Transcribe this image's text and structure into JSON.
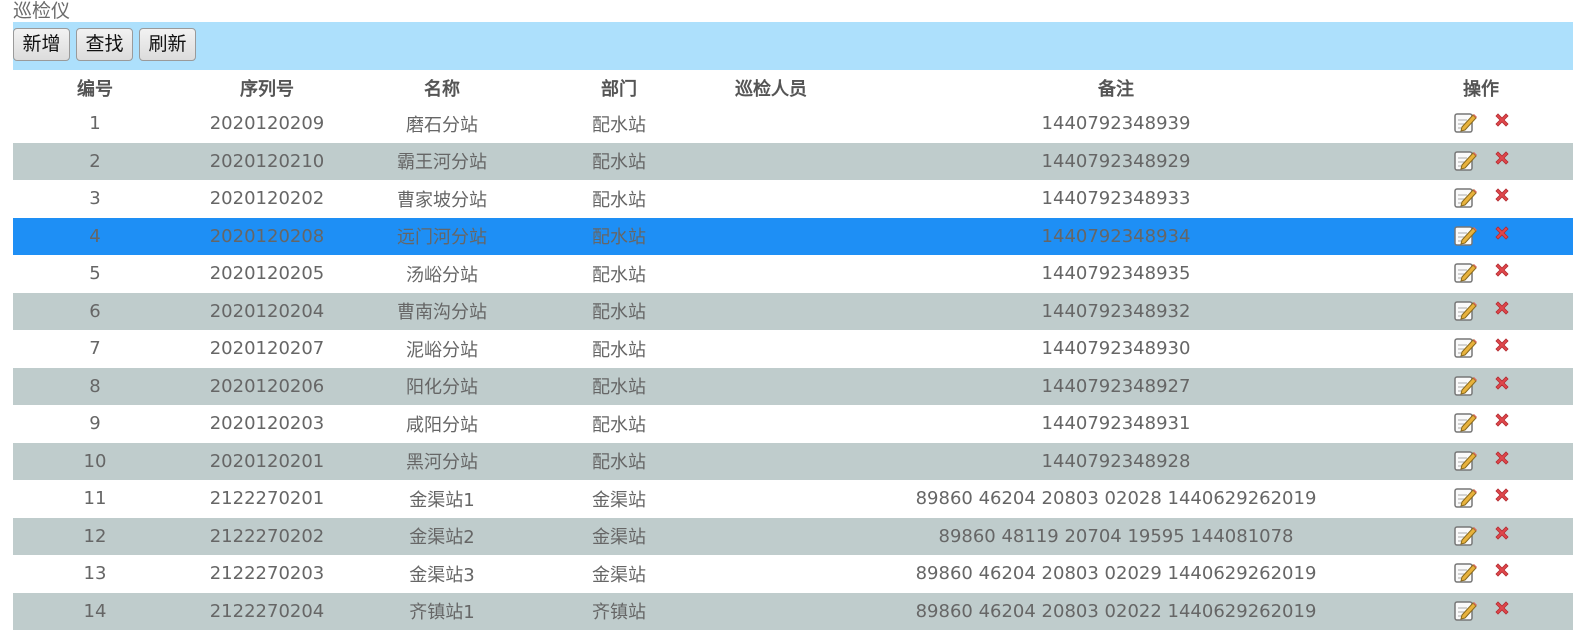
{
  "page": {
    "title": "巡检仪"
  },
  "toolbar": {
    "add_label": "新增",
    "search_label": "查找",
    "refresh_label": "刷新"
  },
  "table": {
    "headers": {
      "no": "编号",
      "seq": "序列号",
      "name": "名称",
      "dept": "部门",
      "inspector": "巡检人员",
      "memo": "备注",
      "ops": "操作"
    },
    "rows": [
      {
        "no": "1",
        "seq": "2020120209",
        "name": "磨石分站",
        "dept": "配水站",
        "inspector": "",
        "memo": "1440792348939"
      },
      {
        "no": "2",
        "seq": "2020120210",
        "name": "霸王河分站",
        "dept": "配水站",
        "inspector": "",
        "memo": "1440792348929"
      },
      {
        "no": "3",
        "seq": "2020120202",
        "name": "曹家坡分站",
        "dept": "配水站",
        "inspector": "",
        "memo": "1440792348933"
      },
      {
        "no": "4",
        "seq": "2020120208",
        "name": "远门河分站",
        "dept": "配水站",
        "inspector": "",
        "memo": "1440792348934",
        "selected": true
      },
      {
        "no": "5",
        "seq": "2020120205",
        "name": "汤峪分站",
        "dept": "配水站",
        "inspector": "",
        "memo": "1440792348935"
      },
      {
        "no": "6",
        "seq": "2020120204",
        "name": "曹南沟分站",
        "dept": "配水站",
        "inspector": "",
        "memo": "1440792348932"
      },
      {
        "no": "7",
        "seq": "2020120207",
        "name": "泥峪分站",
        "dept": "配水站",
        "inspector": "",
        "memo": "1440792348930"
      },
      {
        "no": "8",
        "seq": "2020120206",
        "name": "阳化分站",
        "dept": "配水站",
        "inspector": "",
        "memo": "1440792348927"
      },
      {
        "no": "9",
        "seq": "2020120203",
        "name": "咸阳分站",
        "dept": "配水站",
        "inspector": "",
        "memo": "1440792348931"
      },
      {
        "no": "10",
        "seq": "2020120201",
        "name": "黑河分站",
        "dept": "配水站",
        "inspector": "",
        "memo": "1440792348928"
      },
      {
        "no": "11",
        "seq": "2122270201",
        "name": "金渠站1",
        "dept": "金渠站",
        "inspector": "",
        "memo": "89860 46204 20803 02028 1440629262019"
      },
      {
        "no": "12",
        "seq": "2122270202",
        "name": "金渠站2",
        "dept": "金渠站",
        "inspector": "",
        "memo": "89860 48119 20704 19595 144081078"
      },
      {
        "no": "13",
        "seq": "2122270203",
        "name": "金渠站3",
        "dept": "金渠站",
        "inspector": "",
        "memo": "89860 46204 20803 02029 1440629262019"
      },
      {
        "no": "14",
        "seq": "2122270204",
        "name": "齐镇站1",
        "dept": "齐镇站",
        "inspector": "",
        "memo": "89860 46204 20803 02022 1440629262019"
      }
    ]
  },
  "icons": {
    "edit": "edit-icon",
    "delete": "delete-icon"
  },
  "colors": {
    "toolbar_bg": "#ade0fc",
    "row_alt_bg": "#bfcccc",
    "row_selected_bg": "#1e8ff5",
    "delete_red": "#e0474c"
  }
}
